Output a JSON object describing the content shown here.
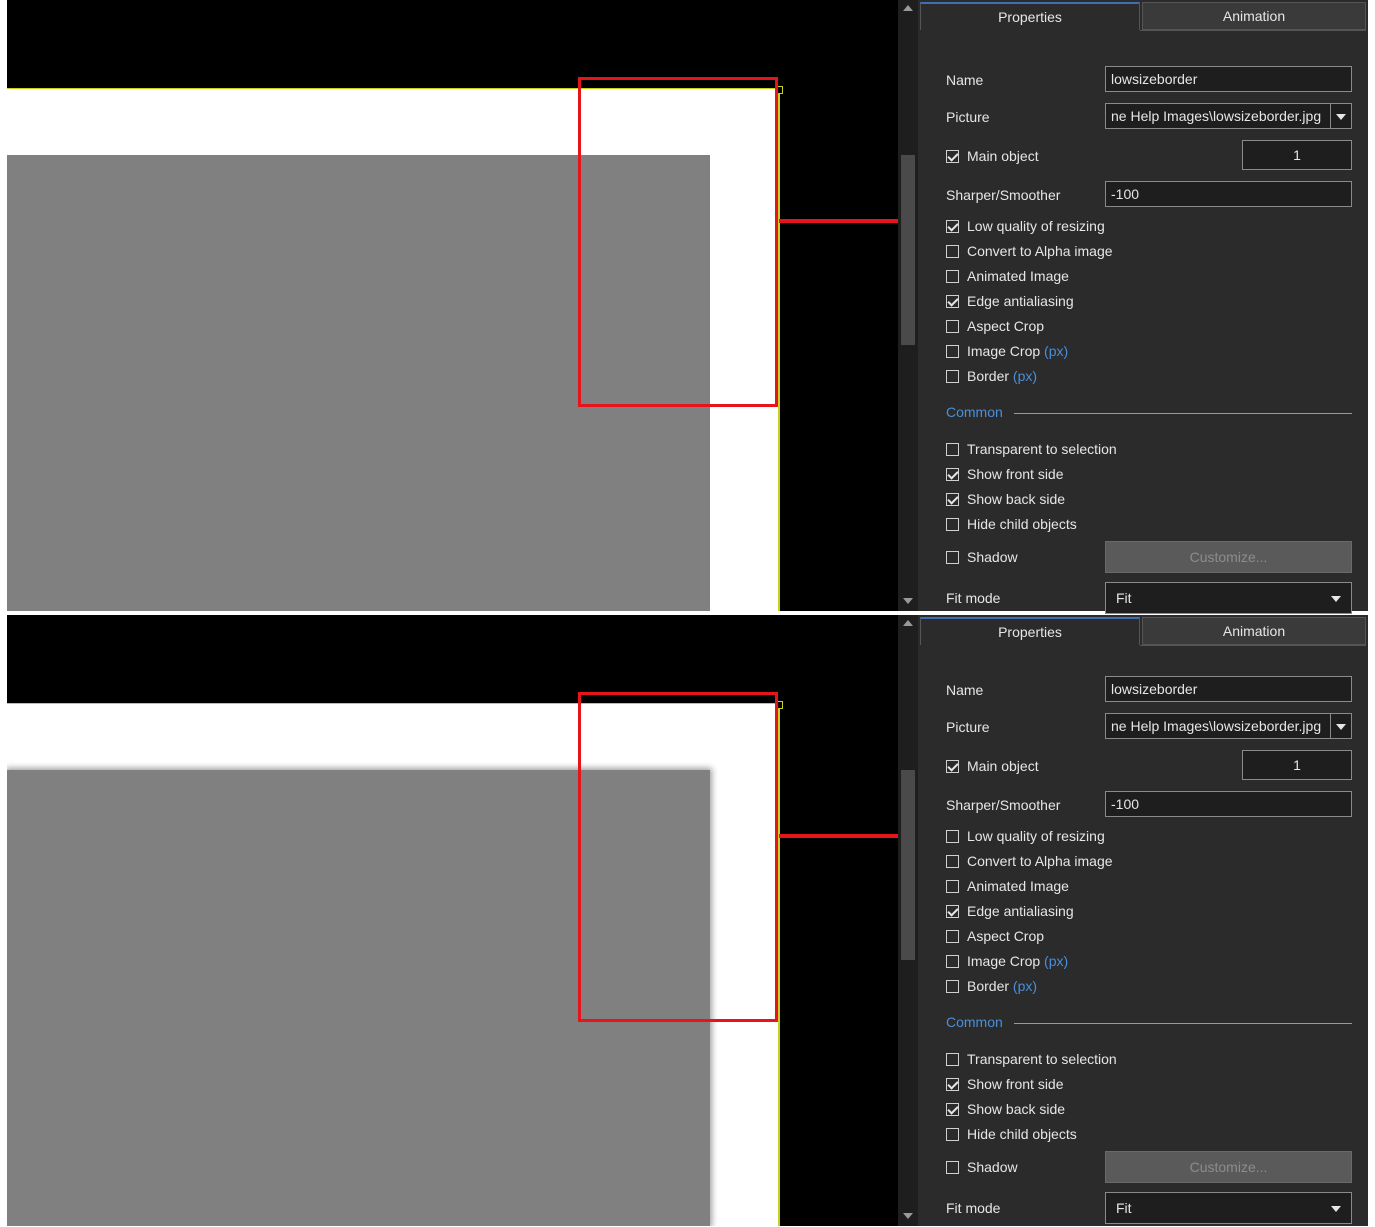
{
  "colors": {
    "accent": "#4a8fd9",
    "annotation_red": "#e8141c",
    "selection": "#c8d21e",
    "panel_bg": "#2b2b2b"
  },
  "screens": [
    {
      "tabs": {
        "properties": "Properties",
        "animation": "Animation"
      },
      "name_label": "Name",
      "name_value": "lowsizeborder",
      "picture_label": "Picture",
      "picture_value": "ne Help Images\\lowsizeborder.jpg",
      "main_object_label": "Main object",
      "main_object_value": "1",
      "sharper_label": "Sharper/Smoother",
      "sharper_value": "-100",
      "low_quality": "Low quality of resizing",
      "convert_alpha": "Convert to Alpha image",
      "animated": "Animated Image",
      "edge_aa": "Edge antialiasing",
      "aspect_crop": "Aspect Crop",
      "image_crop": "Image Crop",
      "image_crop_unit": "(px)",
      "border": "Border",
      "border_unit": "(px)",
      "common": "Common",
      "transparent": "Transparent to selection",
      "front": "Show front side",
      "back": "Show back side",
      "hide_child": "Hide child objects",
      "shadow": "Shadow",
      "customize": "Customize...",
      "fit_label": "Fit mode",
      "fit_value": "Fit"
    },
    {
      "tabs": {
        "properties": "Properties",
        "animation": "Animation"
      },
      "name_label": "Name",
      "name_value": "lowsizeborder",
      "picture_label": "Picture",
      "picture_value": "ne Help Images\\lowsizeborder.jpg",
      "main_object_label": "Main object",
      "main_object_value": "1",
      "sharper_label": "Sharper/Smoother",
      "sharper_value": "-100",
      "low_quality": "Low quality of resizing",
      "convert_alpha": "Convert to Alpha image",
      "animated": "Animated Image",
      "edge_aa": "Edge antialiasing",
      "aspect_crop": "Aspect Crop",
      "image_crop": "Image Crop",
      "image_crop_unit": "(px)",
      "border": "Border",
      "border_unit": "(px)",
      "common": "Common",
      "transparent": "Transparent to selection",
      "front": "Show front side",
      "back": "Show back side",
      "hide_child": "Hide child objects",
      "shadow": "Shadow",
      "customize": "Customize...",
      "fit_label": "Fit mode",
      "fit_value": "Fit"
    }
  ]
}
